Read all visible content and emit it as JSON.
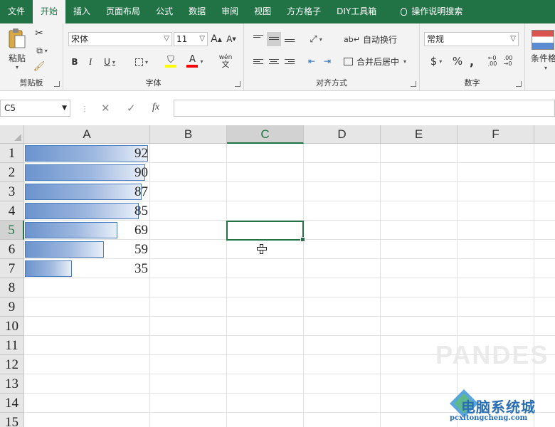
{
  "ribbon_tabs": [
    "文件",
    "开始",
    "插入",
    "页面布局",
    "公式",
    "数据",
    "审阅",
    "视图",
    "方方格子",
    "DIY工具箱",
    "操作说明搜索"
  ],
  "active_tab": "开始",
  "clipboard": {
    "paste_label": "粘贴",
    "group_label": "剪贴板"
  },
  "font": {
    "name": "宋体",
    "size": "11",
    "bold": "B",
    "italic": "I",
    "underline": "U",
    "grow": "A",
    "shrink": "A",
    "color_a": "A",
    "fill_a": "A",
    "wen": "wén",
    "wen_char": "文",
    "group_label": "字体"
  },
  "alignment": {
    "wrap_label": "自动换行",
    "merge_label": "合并后居中",
    "group_label": "对齐方式"
  },
  "number": {
    "format": "常规",
    "currency": "$",
    "percent": "%",
    "comma": ",",
    "group_label": "数字"
  },
  "styles": {
    "cond_label": "条件格"
  },
  "formula_bar": {
    "name_box": "C5",
    "fx": "fx",
    "value": ""
  },
  "columns": [
    "A",
    "B",
    "C",
    "D",
    "E",
    "F"
  ],
  "selected_column": "C",
  "rows": [
    "1",
    "2",
    "3",
    "4",
    "5",
    "6",
    "7",
    "8",
    "9",
    "10",
    "11",
    "12",
    "13",
    "14",
    "15"
  ],
  "selected_row": "5",
  "cells_a": [
    92,
    90,
    87,
    85,
    69,
    59,
    35
  ],
  "databar": {
    "max": 92,
    "color_start": "#6b93cd",
    "color_end": "#e9eff8",
    "border": "#4a7dc0"
  },
  "accent_color": "#217346",
  "watermark": {
    "title": "电脑系统城",
    "subtitle": "pcxitongcheng.com"
  }
}
